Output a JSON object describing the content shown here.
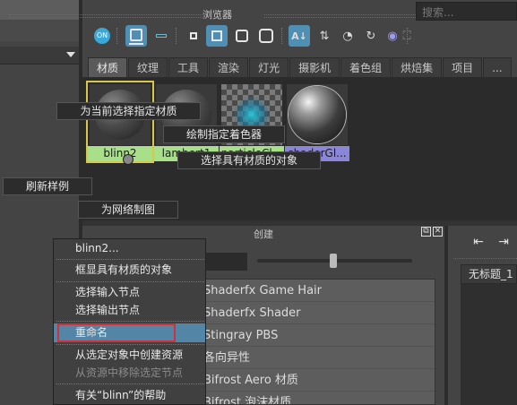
{
  "browser": {
    "title": "浏览器",
    "search_placeholder": "搜索...",
    "tabs": [
      "材质",
      "纹理",
      "工具",
      "渲染",
      "灯光",
      "摄影机",
      "着色组",
      "烘焙集",
      "项目",
      "..."
    ],
    "active_tab": 0,
    "swatches": [
      {
        "label": "blinn2",
        "label_color": "#a8e08a",
        "type": "dark",
        "selected": true
      },
      {
        "label": "lambert1",
        "label_color": "#a8e08a",
        "type": "dark",
        "selected": false
      },
      {
        "label": "particleCl...",
        "label_color": "#a8e08a",
        "type": "checker",
        "selected": false
      },
      {
        "label": "shaderGl...",
        "label_color": "#8c86d8",
        "type": "glossy",
        "selected": false
      }
    ],
    "toolbar_icons": [
      "on-icon",
      "render-view-icon",
      "minus-icon",
      "small-square-icon",
      "medium-square-icon",
      "large-square-icon",
      "xlarge-square-icon",
      "sort-az-icon",
      "sort-type-icon",
      "sort-time-icon",
      "refresh-icon",
      "order-icon",
      "expand-icon"
    ]
  },
  "tooltips": {
    "assign": "为当前选择指定材质",
    "paint": "绘制指定着色器",
    "select_objects": "选择具有材质的对象",
    "refresh": "刷新样例",
    "graph": "为网络制图"
  },
  "create": {
    "title": "创建",
    "items": [
      "Shaderfx Game Hair",
      "Shaderfx Shader",
      "Stingray PBS",
      "各向异性",
      "Bifrost Aero 材质",
      "Bifrost 泡沫材质"
    ]
  },
  "right_panel": {
    "tab": "无标题_1"
  },
  "context_menu": {
    "header": "blinn2...",
    "items": [
      "框显具有材质的对象",
      "选择输入节点",
      "选择输出节点",
      "重命名",
      "从选定对象中创建资源",
      "从资源中移除选定节点",
      "有关“blinn”的帮助"
    ],
    "highlighted_index": 3,
    "disabled_index": 5
  }
}
